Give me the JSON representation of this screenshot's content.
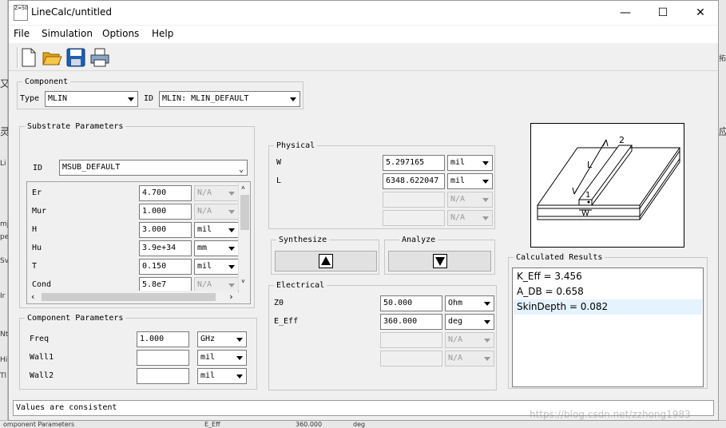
{
  "background": {
    "left_labels": [
      "又",
      "灵",
      "Li",
      "mj",
      "pe",
      "Sv",
      "Ir",
      "Nt",
      "Hi",
      "Tl"
    ],
    "bottom_labels": {
      "left": "omponent Parameters",
      "mid": "E_Eff",
      "value": "360.000",
      "unit": "deg"
    },
    "right_label": "拓",
    "right_label2": "应",
    "watermark": "https://blog.csdn.net/zzhong1983"
  },
  "window": {
    "title": "LineCalc/untitled",
    "icon_text": "Z=50",
    "minimize": "—",
    "maximize": "☐",
    "close": "✕"
  },
  "menu": {
    "file": "File",
    "simulation": "Simulation",
    "options": "Options",
    "help": "Help"
  },
  "toolbar": {
    "icons": [
      "new-file-icon",
      "open-folder-icon",
      "save-disk-icon",
      "print-icon"
    ]
  },
  "component": {
    "legend": "Component",
    "type_label": "Type",
    "type_value": "MLIN",
    "id_label": "ID",
    "id_value": "MLIN: MLIN_DEFAULT"
  },
  "substrate": {
    "legend": "Substrate Parameters",
    "id_label": "ID",
    "id_value": "MSUB_DEFAULT",
    "rows": [
      {
        "label": "Er",
        "value": "4.700",
        "unit": "N/A",
        "unit_disabled": true
      },
      {
        "label": "Mur",
        "value": "1.000",
        "unit": "N/A",
        "unit_disabled": true
      },
      {
        "label": "H",
        "value": "3.000",
        "unit": "mil",
        "unit_disabled": false
      },
      {
        "label": "Hu",
        "value": "3.9e+34",
        "unit": "mm",
        "unit_disabled": false
      },
      {
        "label": "T",
        "value": "0.150",
        "unit": "mil",
        "unit_disabled": false
      },
      {
        "label": "Cond",
        "value": "5.8e7",
        "unit": "N/A",
        "unit_disabled": true
      }
    ]
  },
  "component_params": {
    "legend": "Component Parameters",
    "rows": [
      {
        "label": "Freq",
        "value": "1.000",
        "unit": "GHz"
      },
      {
        "label": "Wall1",
        "value": "",
        "unit": "mil"
      },
      {
        "label": "Wall2",
        "value": "",
        "unit": "mil"
      }
    ]
  },
  "physical": {
    "legend": "Physical",
    "rows": [
      {
        "label": "W",
        "value": "5.297165",
        "unit": "mil",
        "disabled": false
      },
      {
        "label": "L",
        "value": "6348.622047",
        "unit": "mil",
        "disabled": false
      },
      {
        "label": "",
        "value": "",
        "unit": "N/A",
        "disabled": true
      },
      {
        "label": "",
        "value": "",
        "unit": "N/A",
        "disabled": true
      }
    ]
  },
  "synthesize": {
    "legend": "Synthesize",
    "icon": "up-arrow-icon"
  },
  "analyze": {
    "legend": "Analyze",
    "icon": "down-arrow-icon"
  },
  "electrical": {
    "legend": "Electrical",
    "rows": [
      {
        "label": "Z0",
        "value": "50.000",
        "unit": "Ohm",
        "disabled": false
      },
      {
        "label": "E_Eff",
        "value": "360.000",
        "unit": "deg",
        "disabled": false
      },
      {
        "label": "",
        "value": "",
        "unit": "N/A",
        "disabled": true
      },
      {
        "label": "",
        "value": "",
        "unit": "N/A",
        "disabled": true
      }
    ]
  },
  "diagram": {
    "label_L": "L",
    "label_W": "W",
    "label_1": "1",
    "label_2": "2"
  },
  "results": {
    "legend": "Calculated Results",
    "items": [
      "K_Eff = 3.456",
      "A_DB = 0.658",
      "SkinDepth = 0.082"
    ],
    "selected_index": 2,
    "colors": {
      "selected_bg": "#e5f3ff"
    }
  },
  "status": {
    "text": "Values are consistent"
  }
}
